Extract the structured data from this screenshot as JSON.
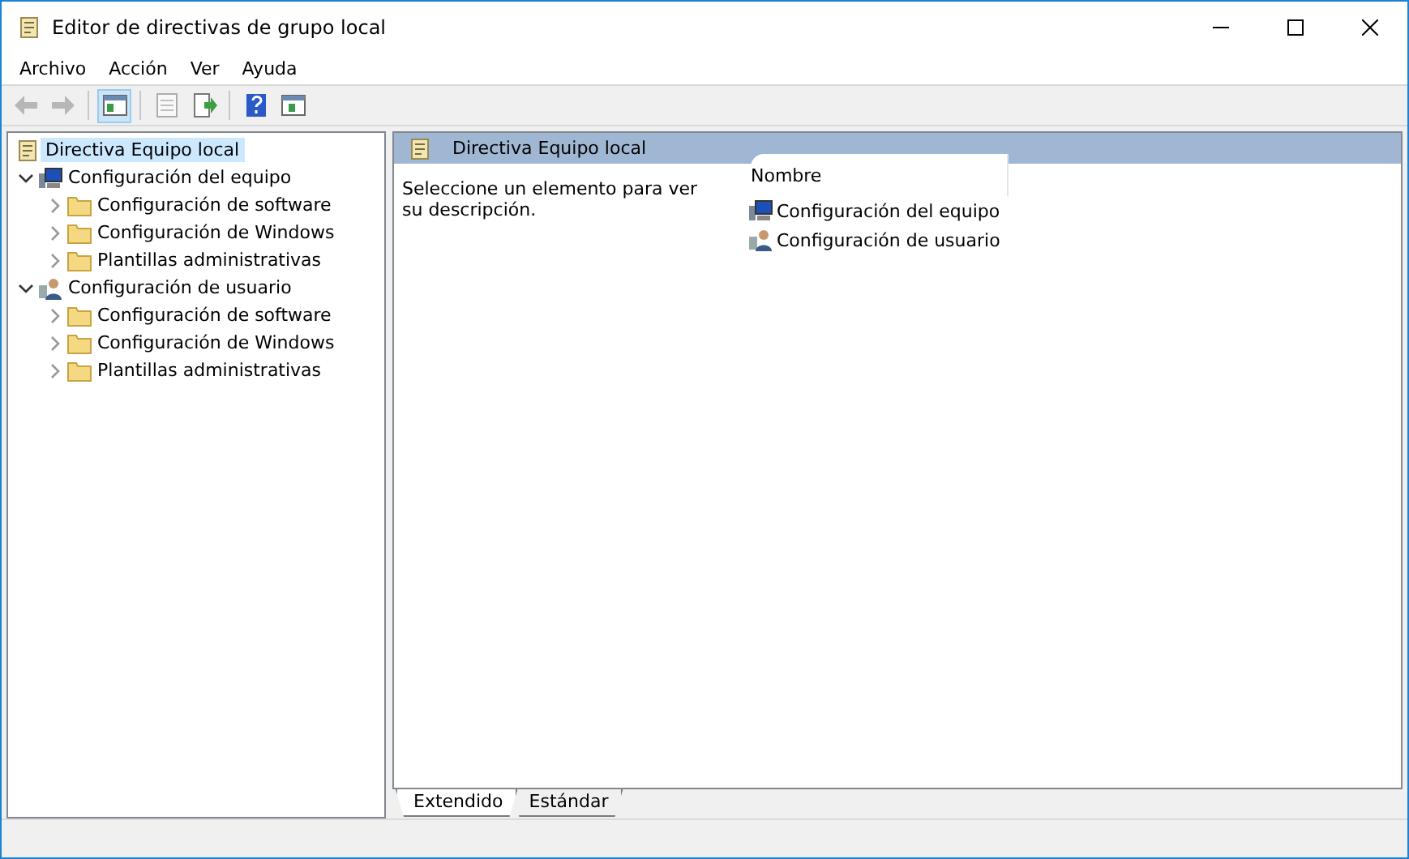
{
  "window": {
    "title": "Editor de directivas de grupo local"
  },
  "menu": [
    "Archivo",
    "Acción",
    "Ver",
    "Ayuda"
  ],
  "toolbar": [
    {
      "kind": "back",
      "disabled": true,
      "pressed": false
    },
    {
      "kind": "forward",
      "disabled": true,
      "pressed": false
    },
    {
      "kind": "tree",
      "disabled": false,
      "pressed": true
    },
    {
      "kind": "properties",
      "disabled": true,
      "pressed": false
    },
    {
      "kind": "export",
      "disabled": false,
      "pressed": false
    },
    {
      "kind": "help",
      "disabled": false,
      "pressed": false
    },
    {
      "kind": "actionpane",
      "disabled": false,
      "pressed": false
    }
  ],
  "tree": [
    {
      "label": "Directiva Equipo local",
      "kind": "policy",
      "selected": true,
      "children": [
        {
          "label": "Configuración del equipo",
          "kind": "computer",
          "selected": false,
          "expanded": true,
          "children": [
            {
              "label": "Configuración de software",
              "kind": "folder",
              "selected": false,
              "expanded": false
            },
            {
              "label": "Configuración de Windows",
              "kind": "folder",
              "selected": false,
              "expanded": false
            },
            {
              "label": "Plantillas administrativas",
              "kind": "folder",
              "selected": false,
              "expanded": false
            }
          ]
        },
        {
          "label": "Configuración de usuario",
          "kind": "user",
          "selected": false,
          "expanded": true,
          "children": [
            {
              "label": "Configuración de software",
              "kind": "folder",
              "selected": false,
              "expanded": false
            },
            {
              "label": "Configuración de Windows",
              "kind": "folder",
              "selected": false,
              "expanded": false
            },
            {
              "label": "Plantillas administrativas",
              "kind": "folder",
              "selected": false,
              "expanded": false
            }
          ]
        }
      ]
    }
  ],
  "details": {
    "title": "Directiva Equipo local",
    "description": "Seleccione un elemento para ver su descripción.",
    "column": "Nombre",
    "items": [
      {
        "label": "Configuración del equipo",
        "kind": "computer"
      },
      {
        "label": "Configuración de usuario",
        "kind": "user"
      }
    ]
  },
  "tabs": [
    {
      "label": "Extendido",
      "selected": true
    },
    {
      "label": "Estándar",
      "selected": false
    }
  ]
}
